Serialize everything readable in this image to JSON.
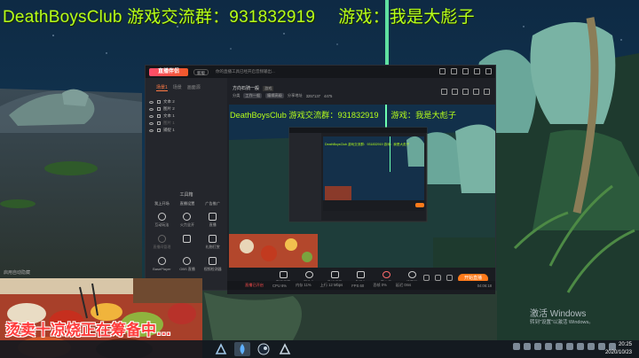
{
  "overlay": {
    "left": "DeathBoysClub 游戏交流群：931832919",
    "right": "游戏：我是大彪子"
  },
  "obs": {
    "logo": "直播伴侣",
    "version_pill": "新版",
    "title_note": "你的直播工具已经开启音频输出...",
    "tabs": [
      "场景1",
      "场景",
      "画面源"
    ],
    "sources": [
      {
        "label": "文本 2",
        "dim": false
      },
      {
        "label": "图片 2",
        "dim": false
      },
      {
        "label": "文本 1",
        "dim": false
      },
      {
        "label": "图片 1",
        "dim": true
      },
      {
        "label": "捕捉 1",
        "dim": false
      }
    ],
    "tools_title": "工具箱",
    "tools_tabs": [
      "我上开场",
      "直播设置",
      "广告推广"
    ],
    "tools": [
      {
        "label": "互动玩法",
        "dim": false,
        "round": true
      },
      {
        "label": "火力全开",
        "dim": false,
        "round": true
      },
      {
        "label": "直播",
        "dim": false,
        "round": false
      },
      {
        "label": "直播间管理",
        "dim": true,
        "round": true
      },
      {
        "label": "",
        "dim": false,
        "round": false
      },
      {
        "label": "礼物打赏",
        "dim": false,
        "round": false
      },
      {
        "label": "BasePlayer",
        "dim": false,
        "round": true
      },
      {
        "label": "OBS 直播",
        "dim": false,
        "round": true
      },
      {
        "label": "视频检测器",
        "dim": false,
        "round": false
      }
    ],
    "footer_left": "开启直播看板",
    "header_title": "方向石骑一般",
    "header_tag": "游戏",
    "sub_items": [
      "分类",
      "工作一般",
      "编辑高级",
      "分享地址",
      "3257137",
      "4475"
    ],
    "preview_overlay_left": "DeathBoysClub 游戏交流群：931832919",
    "preview_overlay_right": "游戏：我是大彪子",
    "bottom_tools": [
      {
        "label": "直播屏幕",
        "red": false,
        "round": false
      },
      {
        "label": "摄像头",
        "red": false,
        "round": true
      },
      {
        "label": "手机投屏",
        "red": false,
        "round": false
      },
      {
        "label": "多媒体",
        "red": false,
        "round": false
      },
      {
        "label": "麦克风",
        "red": true,
        "round": true
      },
      {
        "label": "扬声器",
        "red": false,
        "round": true
      }
    ],
    "live_button": "开始直播",
    "status": {
      "live": "直播已开启",
      "items": [
        "CPU 6%",
        "内存 11%",
        "上行 12 Mbps",
        "FPS 60",
        "丢帧 0%",
        "延迟 0ms"
      ],
      "time": "04:06:18"
    }
  },
  "caption_left": "启用自动隐藏",
  "food_text": "烫卖十凉烧正在筹备中…",
  "activate_windows": {
    "title": "激活 Windows",
    "subtitle": "转到\"设置\"以激活 Windows。"
  },
  "clock": {
    "time": "20:25",
    "date": "2020/10/23"
  }
}
